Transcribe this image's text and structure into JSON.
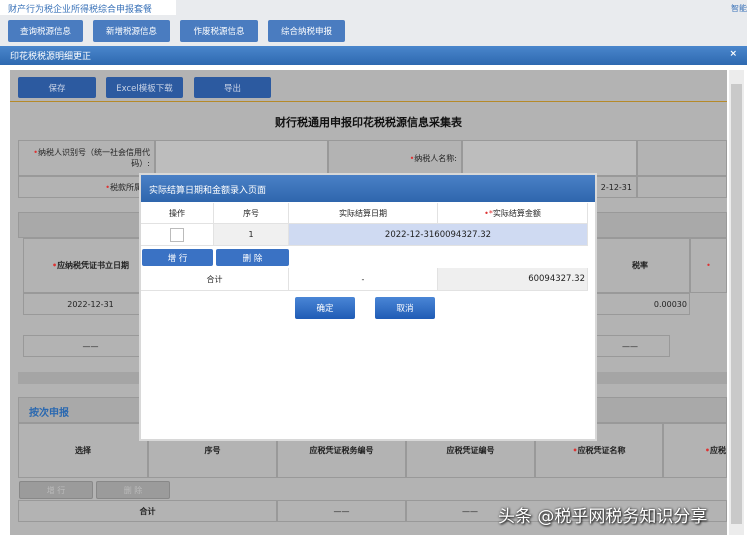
{
  "top_tab": "财产行为税企业所得税综合申报套餐",
  "top_right": "智能",
  "nav": [
    "查询税源信息",
    "新增税源信息",
    "作废税源信息",
    "综合纳税申报"
  ],
  "window": {
    "title": "印花税税源明细更正",
    "close": "×"
  },
  "toolbar": {
    "save": "保存",
    "excel": "Excel模板下载",
    "export": "导出"
  },
  "form": {
    "heading": "财行税通用申报印花税税源信息采集表",
    "taxpayer_id_label": "纳税人识别号（统一社会信用代码）:",
    "taxpayer_name_label": "纳税人名称:",
    "period_label": "税款所属期",
    "period_end": "2-12-31",
    "col_date_label": "应纳税凭证书立日期",
    "col_rate_label": "税率",
    "row_date": "2022-12-31",
    "row_rate": "0.00030",
    "dash": "——"
  },
  "per_time": {
    "title": "按次申报",
    "headers": [
      "选择",
      "序号",
      "应税凭证税务编号",
      "应税凭证编号",
      "应税凭证名称",
      "应税"
    ],
    "add": "增 行",
    "delete": "删 除",
    "total": "合计",
    "dash": "——"
  },
  "modal": {
    "title": "实际结算日期和金额录入页面",
    "headers": [
      "操作",
      "序号",
      "实际结算日期",
      "实际结算金额"
    ],
    "row": {
      "index": "1",
      "value": "2022-12-3160094327.32"
    },
    "add": "增 行",
    "delete": "删 除",
    "total_label": "合计",
    "total_date": "-",
    "total_amount": "60094327.32",
    "ok": "确定",
    "cancel": "取消"
  },
  "watermark": "头条 @税乎网税务知识分享"
}
